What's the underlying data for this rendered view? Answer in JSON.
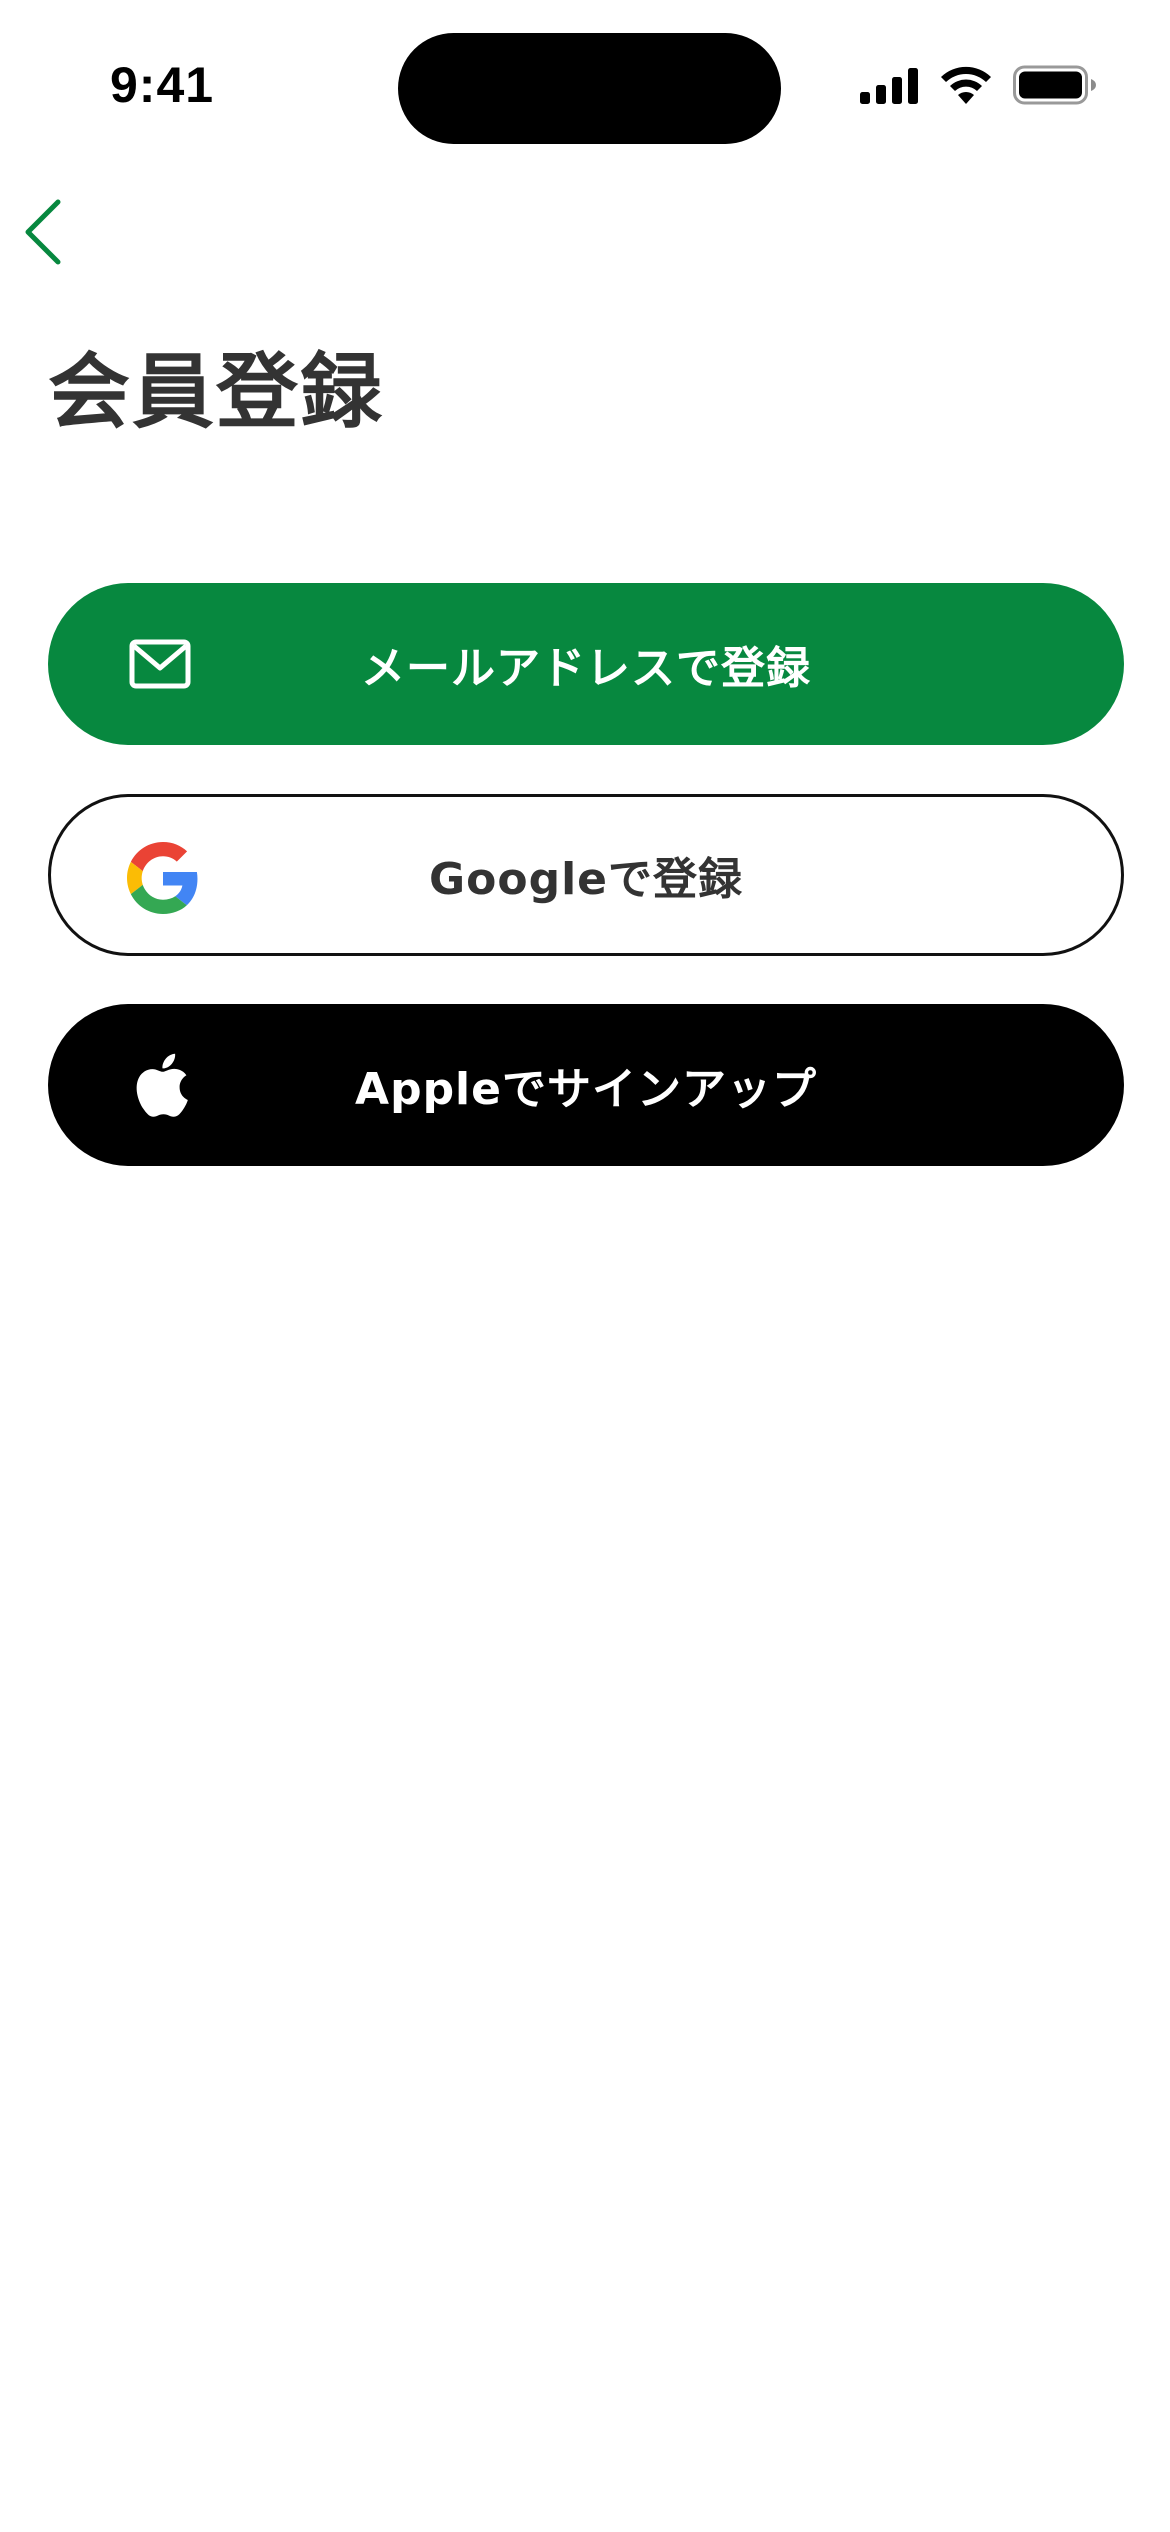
{
  "status_bar": {
    "time": "9:41"
  },
  "nav": {
    "back_icon": "chevron-left-icon",
    "accent_color": "#07883f"
  },
  "page": {
    "title": "会員登録"
  },
  "buttons": {
    "email": {
      "label": "メールアドレスで登録",
      "icon": "mail-icon",
      "background": "#07883f"
    },
    "google": {
      "label": "Googleで登録",
      "icon": "google-icon",
      "background": "#ffffff"
    },
    "apple": {
      "label": "Appleでサインアップ",
      "icon": "apple-icon",
      "background": "#000000"
    }
  }
}
